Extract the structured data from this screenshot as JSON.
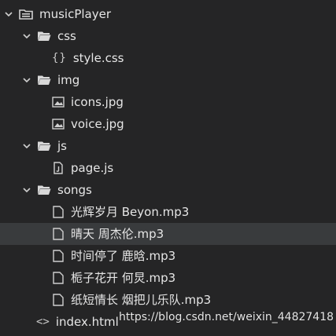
{
  "tree": {
    "root": {
      "label": "musicPlayer"
    },
    "css_folder": {
      "label": "css"
    },
    "style_css": {
      "label": "style.css"
    },
    "img_folder": {
      "label": "img"
    },
    "icons_jpg": {
      "label": "icons.jpg"
    },
    "voice_jpg": {
      "label": "voice.jpg"
    },
    "js_folder": {
      "label": "js"
    },
    "page_js": {
      "label": "page.js"
    },
    "songs_folder": {
      "label": "songs"
    },
    "songs": [
      {
        "label": "光辉岁月 Beyon.mp3"
      },
      {
        "label": "晴天 周杰伦.mp3"
      },
      {
        "label": "时间停了 鹿晗.mp3"
      },
      {
        "label": "栀子花开 何炅.mp3"
      },
      {
        "label": "纸短情长 烟把儿乐队.mp3"
      }
    ],
    "index_html": {
      "label": "index.html"
    }
  },
  "icons": {
    "css_glyph": "{}",
    "html_glyph": "<>"
  },
  "watermark": "https://blog.csdn.net/weixin_44827418"
}
